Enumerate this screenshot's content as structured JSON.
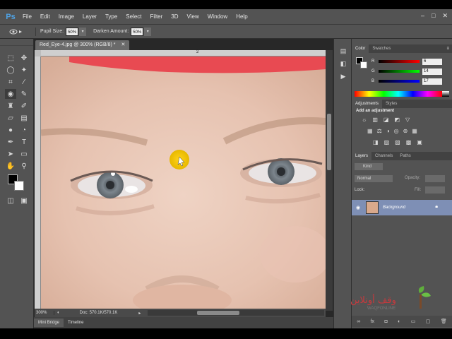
{
  "app": {
    "logo": "Ps"
  },
  "menu": [
    "File",
    "Edit",
    "Image",
    "Layer",
    "Type",
    "Select",
    "Filter",
    "3D",
    "View",
    "Window",
    "Help"
  ],
  "window_controls": [
    "–",
    "□",
    "✕"
  ],
  "options_bar": {
    "pupil_size_label": "Pupil Size:",
    "pupil_size_value": "50%",
    "darken_label": "Darken Amount:",
    "darken_value": "50%"
  },
  "document": {
    "tab_title": "Red_Eye-4.jpg @ 300% (RGB/8) *",
    "ruler_mark": "2",
    "zoom": "300%",
    "doc_size": "Doc: 570.1K/570.1K"
  },
  "bottom_tabs": [
    "Mini Bridge",
    "Timeline"
  ],
  "color_panel": {
    "tabs": [
      "Color",
      "Swatches"
    ],
    "r_label": "R",
    "r_value": "6",
    "g_label": "G",
    "g_value": "14",
    "b_label": "B",
    "b_value": "17"
  },
  "adjustments_panel": {
    "tabs": [
      "Adjustments",
      "Styles"
    ],
    "heading": "Add an adjustment"
  },
  "layers_panel": {
    "tabs": [
      "Layers",
      "Channels",
      "Paths"
    ],
    "kind_label": "Kind",
    "blend_mode": "Normal",
    "opacity_label": "Opacity:",
    "lock_label": "Lock:",
    "fill_label": "Fill:",
    "layer_name": "Background"
  },
  "watermark": {
    "arabic": "وقف أونلاين",
    "latin": "WAQFONLINE"
  },
  "colors": {
    "accent": "#4fa3e6",
    "chrome": "#535353",
    "selected_layer": "#7e8fb5",
    "red_band": "#e84a52"
  },
  "icons": [
    "ps-logo",
    "marquee-icon",
    "lasso-icon",
    "crop-icon",
    "eyedropper-icon",
    "red-eye-icon",
    "brush-icon",
    "stamp-icon",
    "history-brush-icon",
    "eraser-icon",
    "gradient-icon",
    "dodge-icon",
    "pen-icon",
    "type-icon",
    "path-select-icon",
    "shape-icon",
    "hand-icon",
    "zoom-icon",
    "eye-icon",
    "lock-icon",
    "cursor-highlight-icon"
  ]
}
